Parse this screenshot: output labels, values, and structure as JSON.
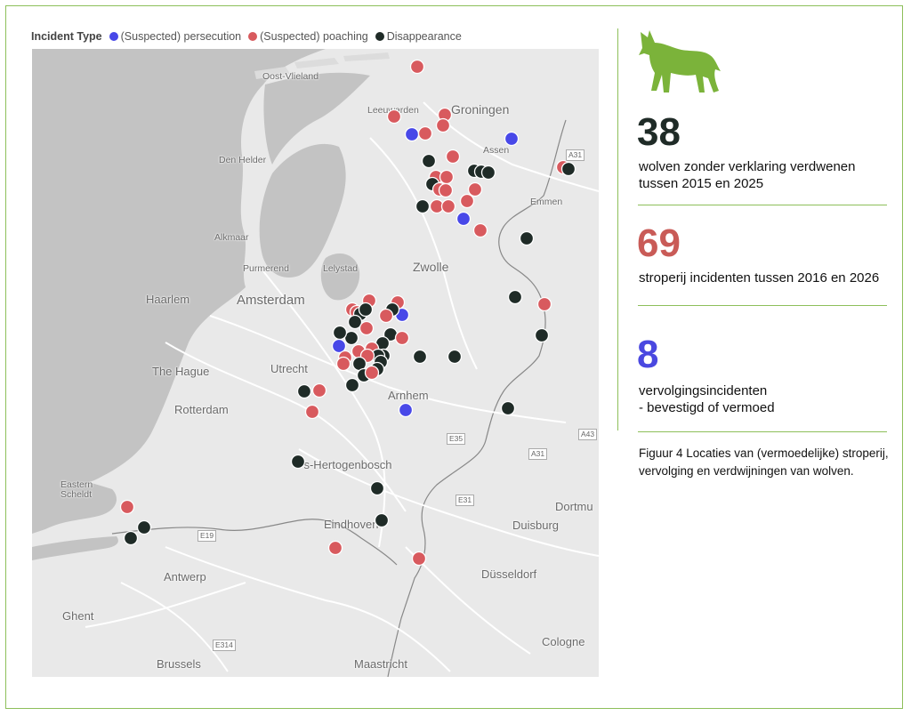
{
  "legend": {
    "title": "Incident Type",
    "items": [
      {
        "label": "(Suspected) persecution",
        "color": "#4848e8"
      },
      {
        "label": "(Suspected) poaching",
        "color": "#d85a5e"
      },
      {
        "label": "Disappearance",
        "color": "#1f2b27"
      }
    ]
  },
  "map": {
    "places": {
      "oost_vlieland": "Oost-Vlieland",
      "leeuwarden": "Leeuwarden",
      "groningen": "Groningen",
      "assen": "Assen",
      "den_helder": "Den Helder",
      "emmen": "Emmen",
      "alkmaar": "Alkmaar",
      "purmerend": "Purmerend",
      "lelystad": "Lelystad",
      "zwolle": "Zwolle",
      "haarlem": "Haarlem",
      "amsterdam": "Amsterdam",
      "the_hague": "The Hague",
      "utrecht": "Utrecht",
      "rotterdam": "Rotterdam",
      "arnhem": "Arnhem",
      "s_hertogenbosch": "'s-Hertogenbosch",
      "eastern_scheldt": "Eastern\nScheldt",
      "eindhoven": "Eindhoven",
      "dortmund": "Dortmu",
      "duisburg": "Duisburg",
      "antwerp": "Antwerp",
      "dusseldorf": "Düsseldorf",
      "ghent": "Ghent",
      "brussels": "Brussels",
      "maastricht": "Maastricht",
      "cologne": "Cologne"
    },
    "roads": {
      "a31_top": "A31",
      "e35": "E35",
      "a43": "A43",
      "a31_mid": "A31",
      "e31": "E31",
      "e19": "E19",
      "e314": "E314"
    },
    "incident_colors": {
      "persecution": "#4848e8",
      "poaching": "#d85a5e",
      "disappearance": "#1f2b27"
    }
  },
  "stats": [
    {
      "number": "38",
      "color": "#1f2b27",
      "text": "wolven zonder verklaring verdwenen tussen 2015 en 2025"
    },
    {
      "number": "69",
      "color": "#c95b57",
      "text": "stroperij incidenten tussen 2016 en 2026"
    },
    {
      "number": "8",
      "color": "#4a48e0",
      "text": "vervolgingsincidenten\n- bevestigd of vermoed"
    }
  ],
  "caption": "Figuur 4 Locaties van (vermoedelijke) stroperij, vervolging en verdwijningen van wolven.",
  "wolf_icon": {
    "name": "wolf-icon",
    "color": "#7bb33a"
  }
}
